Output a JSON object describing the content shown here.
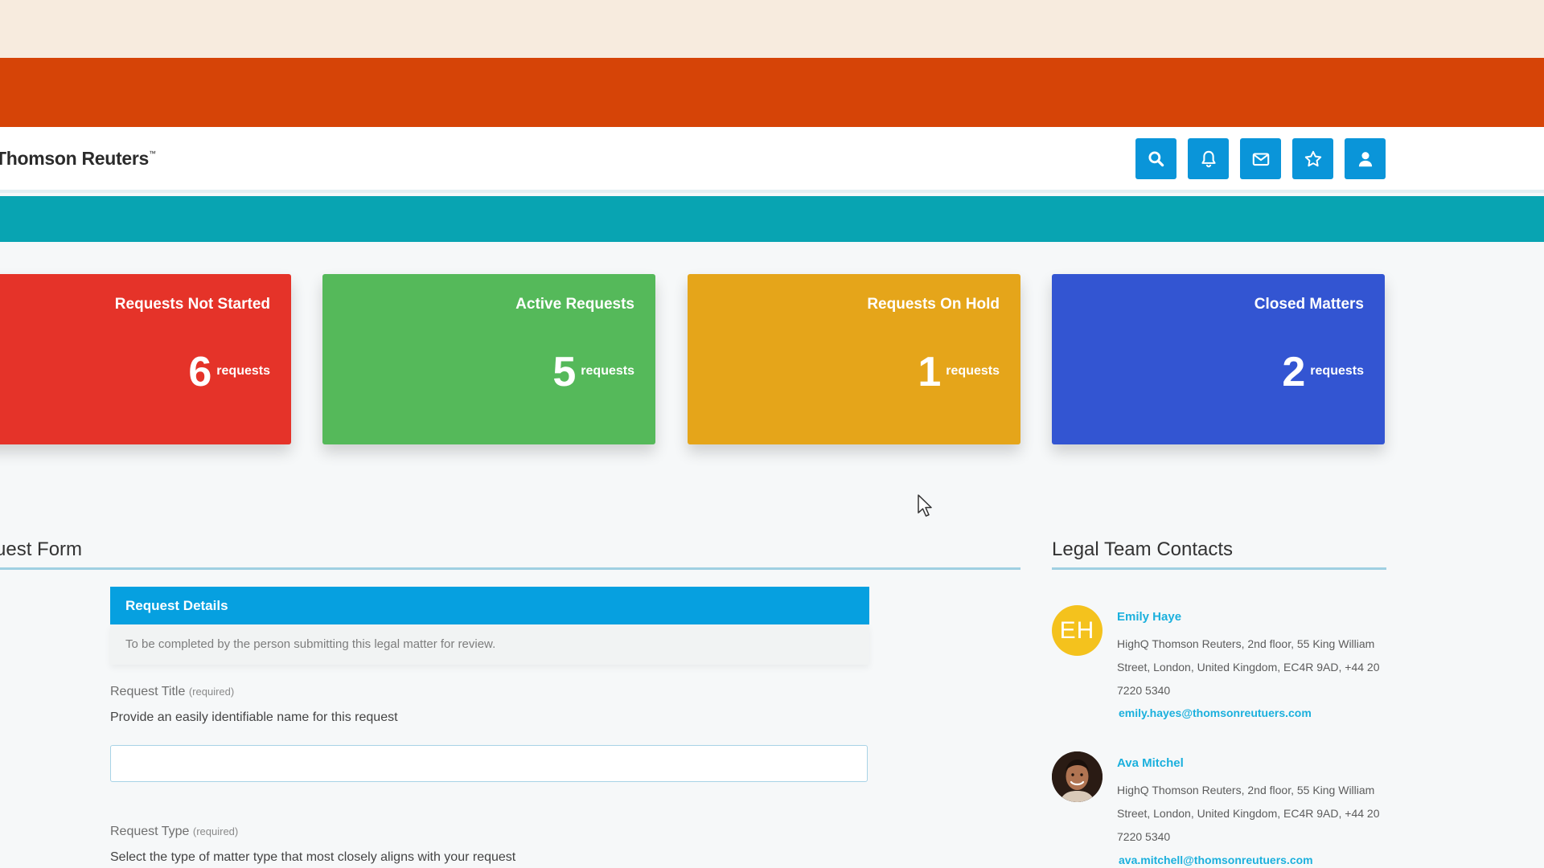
{
  "brand": {
    "name": "Thomson Reuters",
    "trademark": "™"
  },
  "colors": {
    "cream": "#f7ebde",
    "orange": "#d64407",
    "teal": "#08a4b2",
    "icon_blue": "#0a95d9",
    "link_blue": "#1bb0dd"
  },
  "header_icons": [
    {
      "icon": "search-icon"
    },
    {
      "icon": "bell-icon"
    },
    {
      "icon": "mail-icon"
    },
    {
      "icon": "star-icon"
    },
    {
      "icon": "user-icon"
    }
  ],
  "stats": [
    {
      "title": "Requests Not Started",
      "value": "6",
      "unit": "requests",
      "color": "#e53329"
    },
    {
      "title": "Active Requests",
      "value": "5",
      "unit": "requests",
      "color": "#55b95a"
    },
    {
      "title": "Requests On Hold",
      "value": "1",
      "unit": "requests",
      "color": "#e5a51a"
    },
    {
      "title": "Closed Matters",
      "value": "2",
      "unit": "requests",
      "color": "#3355d2"
    }
  ],
  "request_form": {
    "title": "uest Form",
    "banner": "Request Details",
    "note": "To be completed by the person submitting this legal matter for review.",
    "fields": [
      {
        "label": "Request Title",
        "required": "(required)",
        "help": "Provide an easily identifiable name for this request",
        "value": ""
      },
      {
        "label": "Request Type",
        "required": "(required)",
        "help": "Select the type of matter type that most closely aligns with your request"
      }
    ]
  },
  "contacts": {
    "title": "Legal Team Contacts",
    "people": [
      {
        "initials": "EH",
        "name": "Emily Haye",
        "address": "HighQ Thomson Reuters, 2nd floor, 55 King William Street, London, United Kingdom, EC4R 9AD, +44 20 7220 5340",
        "email": "emily.hayes@thomsonreutuers.com"
      },
      {
        "initials": "",
        "name": "Ava Mitchel",
        "address": "HighQ Thomson Reuters, 2nd floor, 55 King William Street, London, United Kingdom, EC4R 9AD, +44 20 7220 5340",
        "email": "ava.mitchell@thomsonreutuers.com"
      }
    ]
  }
}
